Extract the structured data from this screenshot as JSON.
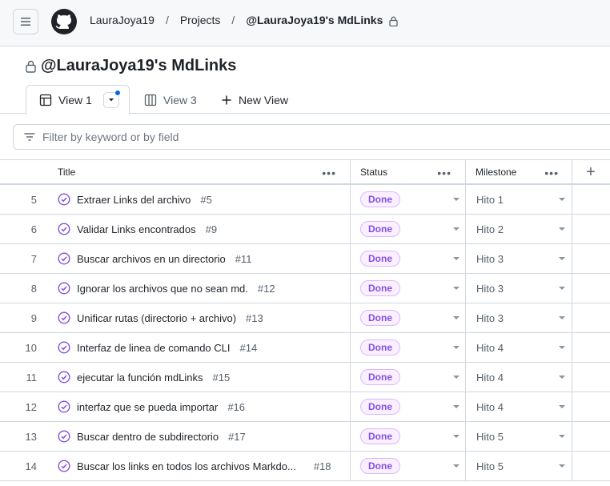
{
  "breadcrumb": {
    "owner": "LauraJoya19",
    "section": "Projects",
    "project": "@LauraJoya19's MdLinks"
  },
  "project_title": "@LauraJoya19's MdLinks",
  "views": [
    {
      "label": "View 1"
    },
    {
      "label": "View 3"
    },
    {
      "label": "New View"
    }
  ],
  "filter": {
    "placeholder": "Filter by keyword or by field"
  },
  "columns": {
    "title": "Title",
    "status": "Status",
    "milestone": "Milestone",
    "menu": "•••",
    "add": "+"
  },
  "rows": [
    {
      "index": "5",
      "title": "Extraer Links del archivo",
      "issue": "#5",
      "status": "Done",
      "milestone": "Hito 1"
    },
    {
      "index": "6",
      "title": "Validar Links encontrados",
      "issue": "#9",
      "status": "Done",
      "milestone": "Hito 2"
    },
    {
      "index": "7",
      "title": "Buscar archivos en un directorio",
      "issue": "#11",
      "status": "Done",
      "milestone": "Hito 3"
    },
    {
      "index": "8",
      "title": "Ignorar los archivos que no sean md.",
      "issue": "#12",
      "status": "Done",
      "milestone": "Hito 3"
    },
    {
      "index": "9",
      "title": "Unificar rutas (directorio + archivo)",
      "issue": "#13",
      "status": "Done",
      "milestone": "Hito 3"
    },
    {
      "index": "10",
      "title": "Interfaz de linea de comando CLI",
      "issue": "#14",
      "status": "Done",
      "milestone": "Hito 4"
    },
    {
      "index": "11",
      "title": "ejecutar la función mdLinks",
      "issue": "#15",
      "status": "Done",
      "milestone": "Hito 4"
    },
    {
      "index": "12",
      "title": "interfaz que se pueda importar",
      "issue": "#16",
      "status": "Done",
      "milestone": "Hito 4"
    },
    {
      "index": "13",
      "title": "Buscar dentro de subdirectorio",
      "issue": "#17",
      "status": "Done",
      "milestone": "Hito 5"
    },
    {
      "index": "14",
      "title": "Buscar los links en todos los archivos Markdo...",
      "issue": "#18",
      "status": "Done",
      "milestone": "Hito 5"
    }
  ],
  "colors": {
    "accent": "#0969da",
    "done_badge": "#8250df",
    "closed_icon": "#8250df"
  }
}
